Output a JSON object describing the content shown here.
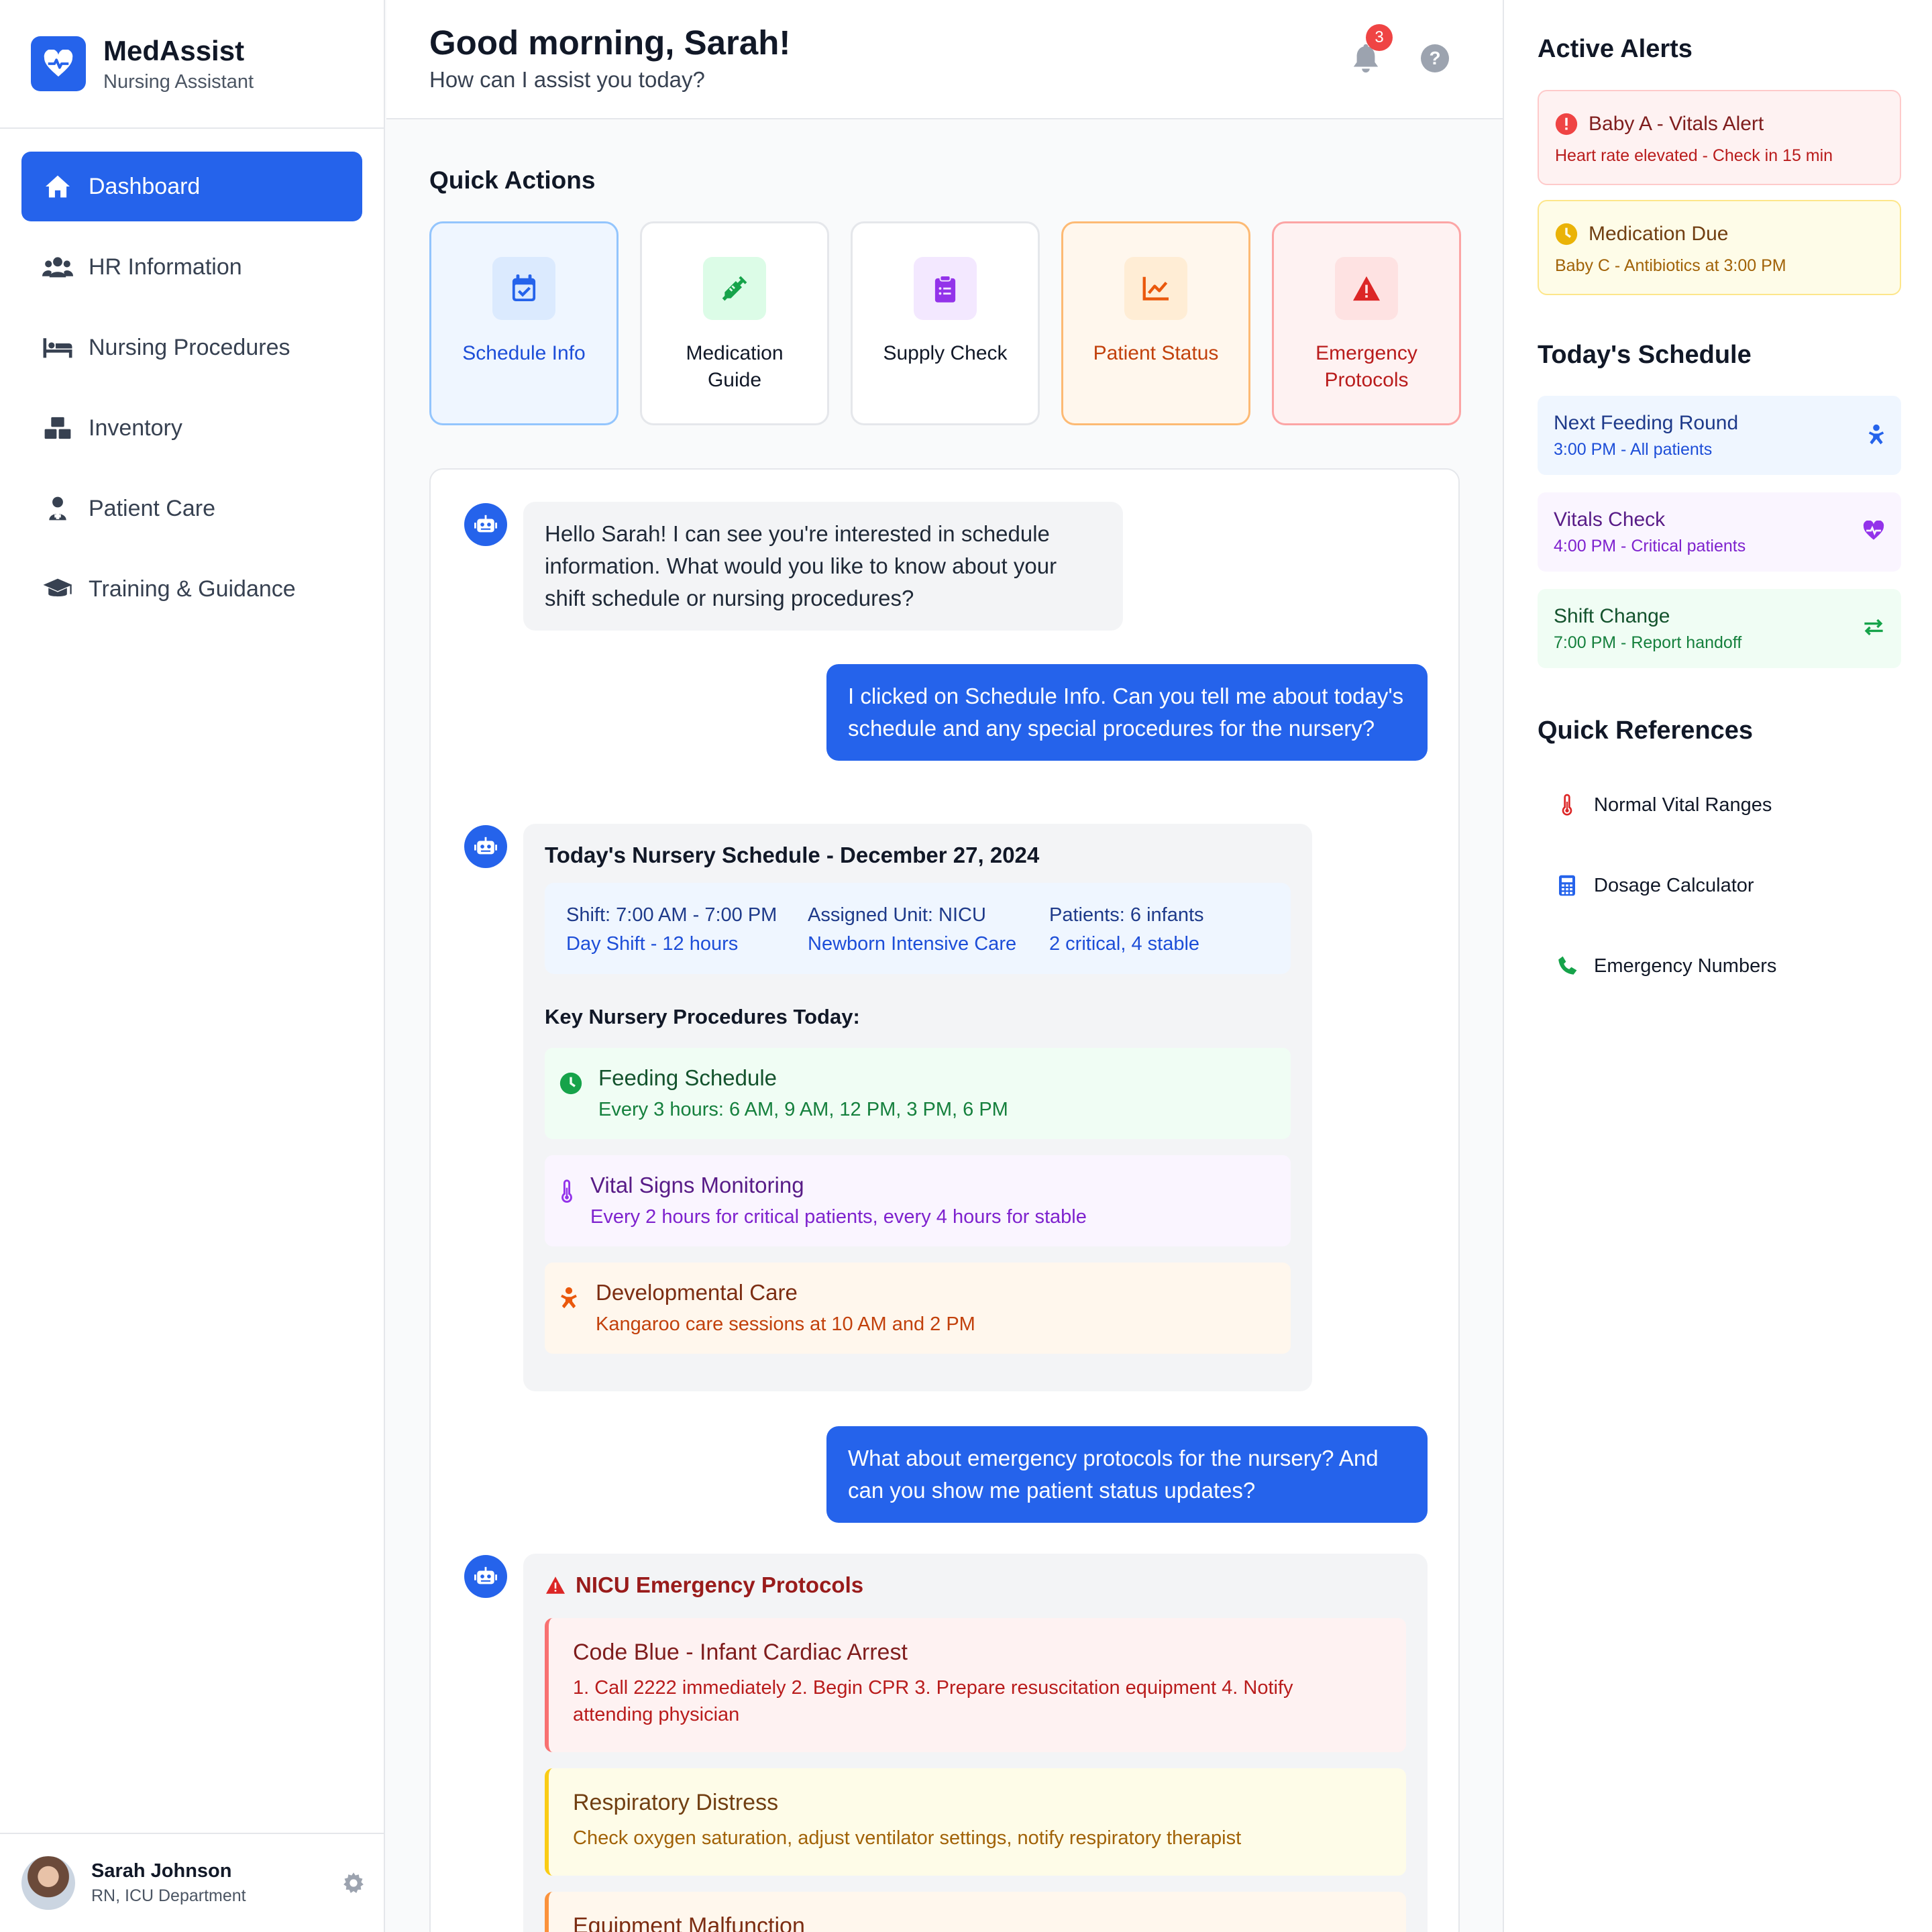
{
  "brand": {
    "name": "MedAssist",
    "subtitle": "Nursing Assistant",
    "logo_icon": "heart-pulse-icon"
  },
  "nav": [
    {
      "label": "Dashboard",
      "icon": "home-icon",
      "active": true
    },
    {
      "label": "HR Information",
      "icon": "users-icon"
    },
    {
      "label": "Nursing Procedures",
      "icon": "procedure-bed-icon"
    },
    {
      "label": "Inventory",
      "icon": "boxes-icon"
    },
    {
      "label": "Patient Care",
      "icon": "patient-icon"
    },
    {
      "label": "Training & Guidance",
      "icon": "graduation-cap-icon"
    }
  ],
  "user": {
    "name": "Sarah Johnson",
    "role": "RN, ICU Department"
  },
  "header": {
    "greeting": "Good morning, Sarah!",
    "subtitle": "How can I assist you today?",
    "notification_count": "3",
    "help_glyph": "?"
  },
  "quick_actions": {
    "title": "Quick Actions",
    "items": [
      {
        "label": "Schedule Info",
        "icon": "calendar-check-icon",
        "color": "#2563eb"
      },
      {
        "label": "Medication Guide",
        "icon": "syringe-icon",
        "color": "#16a34a"
      },
      {
        "label": "Supply Check",
        "icon": "clipboard-list-icon",
        "color": "#9333ea"
      },
      {
        "label": "Patient Status",
        "icon": "chart-line-icon",
        "color": "#ea580c"
      },
      {
        "label": "Emergency Protocols",
        "icon": "warning-triangle-icon",
        "color": "#dc2626"
      }
    ]
  },
  "chat": {
    "bot_msg_1": "Hello Sarah! I can see you're interested in schedule information. What would you like to know about your shift schedule or nursing procedures?",
    "user_msg_1": "I clicked on Schedule Info. Can you tell me about today's schedule and any special procedures for the nursery?",
    "schedule": {
      "title": "Today's Nursery Schedule - December 27, 2024",
      "info": [
        {
          "a": "Shift: 7:00 AM - 7:00 PM",
          "b": "Day Shift - 12 hours"
        },
        {
          "a": "Assigned Unit: NICU",
          "b": "Newborn Intensive Care"
        },
        {
          "a": "Patients: 6 infants",
          "b": "2 critical, 4 stable"
        }
      ],
      "procedures_title": "Key Nursery Procedures Today:",
      "procedures": [
        {
          "title": "Feeding Schedule",
          "sub": "Every 3 hours: 6 AM, 9 AM, 12 PM, 3 PM, 6 PM",
          "icon": "clock-icon"
        },
        {
          "title": "Vital Signs Monitoring",
          "sub": "Every 2 hours for critical patients, every 4 hours for stable",
          "icon": "thermometer-icon"
        },
        {
          "title": "Developmental Care",
          "sub": "Kangaroo care sessions at 10 AM and 2 PM",
          "icon": "baby-icon"
        }
      ]
    },
    "user_msg_2": "What about emergency protocols for the nursery? And can you show me patient status updates?",
    "emergency": {
      "title": "NICU Emergency Protocols",
      "cards": [
        {
          "title": "Code Blue - Infant Cardiac Arrest",
          "sub": "1. Call 2222 immediately 2. Begin CPR 3. Prepare resuscitation equipment 4. Notify attending physician"
        },
        {
          "title": "Respiratory Distress",
          "sub": "Check oxygen saturation, adjust ventilator settings, notify respiratory therapist"
        },
        {
          "title": "Equipment Malfunction",
          "sub": ""
        }
      ]
    }
  },
  "right": {
    "alerts_title": "Active Alerts",
    "alerts": [
      {
        "title": "Baby A - Vitals Alert",
        "sub": "Heart rate elevated - Check in 15 min"
      },
      {
        "title": "Medication Due",
        "sub": "Baby C - Antibiotics at 3:00 PM"
      }
    ],
    "schedule_title": "Today's Schedule",
    "schedule": [
      {
        "title": "Next Feeding Round",
        "sub": "3:00 PM - All patients",
        "icon": "baby-icon"
      },
      {
        "title": "Vitals Check",
        "sub": "4:00 PM - Critical patients",
        "icon": "heart-pulse-icon"
      },
      {
        "title": "Shift Change",
        "sub": "7:00 PM - Report handoff",
        "icon": "exchange-arrows-icon"
      }
    ],
    "refs_title": "Quick References",
    "refs": [
      {
        "label": "Normal Vital Ranges",
        "icon": "thermometer-icon"
      },
      {
        "label": "Dosage Calculator",
        "icon": "calculator-icon"
      },
      {
        "label": "Emergency Numbers",
        "icon": "phone-icon"
      }
    ]
  }
}
